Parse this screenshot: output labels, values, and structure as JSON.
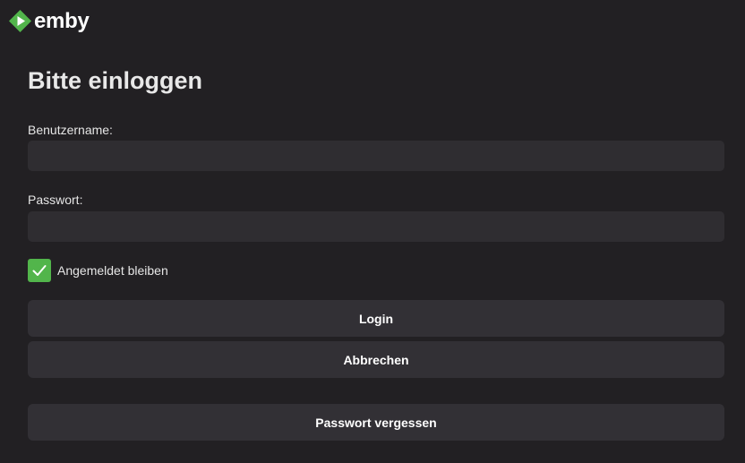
{
  "brand": {
    "name": "emby",
    "logo_icon": "emby-logo-icon",
    "logo_color": "#52b54b"
  },
  "page": {
    "title": "Bitte einloggen"
  },
  "form": {
    "username_label": "Benutzername:",
    "username_value": "",
    "password_label": "Passwort:",
    "password_value": "",
    "remember_label": "Angemeldet bleiben",
    "remember_checked": true,
    "checkbox_color": "#52b54b"
  },
  "buttons": {
    "login": "Login",
    "cancel": "Abbrechen",
    "forgot_password": "Passwort vergessen"
  },
  "colors": {
    "background": "#222023",
    "input_background": "#2f2d31",
    "button_background": "#323035",
    "accent": "#52b54b"
  }
}
